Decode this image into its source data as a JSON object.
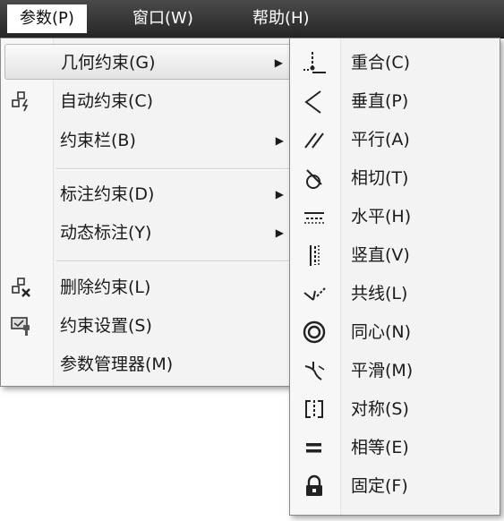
{
  "menubar": {
    "items": [
      {
        "label": "参数(P)"
      },
      {
        "label": "窗口(W)"
      },
      {
        "label": "帮助(H)"
      }
    ]
  },
  "menu": {
    "items": [
      {
        "label": "几何约束(G)",
        "submenu": true,
        "icon": null
      },
      {
        "label": "自动约束(C)",
        "submenu": false,
        "icon": "auto-constraint-icon"
      },
      {
        "label": "约束栏(B)",
        "submenu": true,
        "icon": null
      },
      {
        "label": "标注约束(D)",
        "submenu": true,
        "icon": null
      },
      {
        "label": "动态标注(Y)",
        "submenu": true,
        "icon": null
      },
      {
        "label": "删除约束(L)",
        "submenu": false,
        "icon": "delete-constraint-icon"
      },
      {
        "label": "约束设置(S)",
        "submenu": false,
        "icon": "constraint-settings-icon"
      },
      {
        "label": "参数管理器(M)",
        "submenu": false,
        "icon": null
      }
    ]
  },
  "submenu": {
    "items": [
      {
        "label": "重合(C)",
        "icon": "coincident-icon"
      },
      {
        "label": "垂直(P)",
        "icon": "perpendicular-icon"
      },
      {
        "label": "平行(A)",
        "icon": "parallel-icon"
      },
      {
        "label": "相切(T)",
        "icon": "tangent-icon"
      },
      {
        "label": "水平(H)",
        "icon": "horizontal-icon"
      },
      {
        "label": "竖直(V)",
        "icon": "vertical-icon"
      },
      {
        "label": "共线(L)",
        "icon": "collinear-icon"
      },
      {
        "label": "同心(N)",
        "icon": "concentric-icon"
      },
      {
        "label": "平滑(M)",
        "icon": "smooth-icon"
      },
      {
        "label": "对称(S)",
        "icon": "symmetric-icon"
      },
      {
        "label": "相等(E)",
        "icon": "equal-icon"
      },
      {
        "label": "固定(F)",
        "icon": "fix-icon"
      }
    ]
  },
  "arrow_glyph": "▶"
}
